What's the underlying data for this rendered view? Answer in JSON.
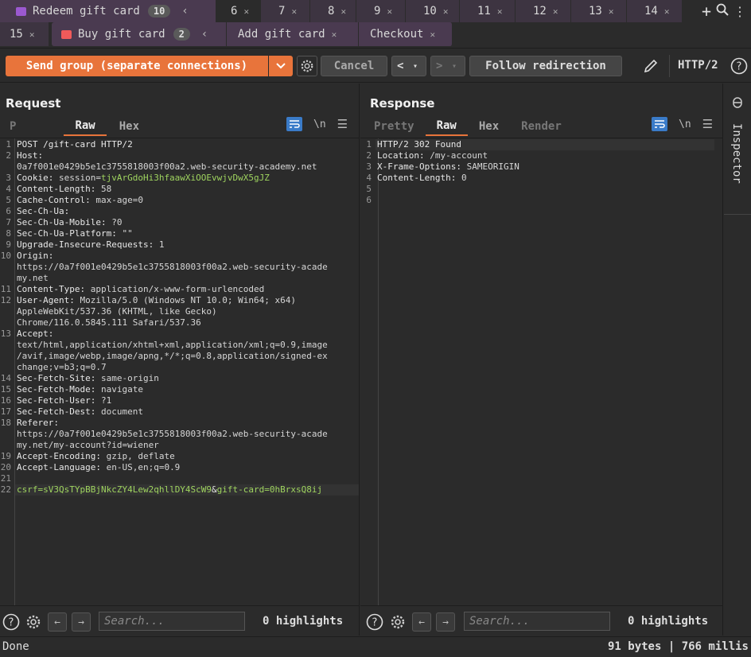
{
  "tabs_row1": {
    "group": {
      "label": "Redeem gift card",
      "count": "10"
    },
    "tabs": [
      "6",
      "7",
      "8",
      "9",
      "10",
      "11",
      "12",
      "13",
      "14"
    ],
    "active": "6"
  },
  "tabs_row2": {
    "first": "15",
    "group": {
      "label": "Buy gift card",
      "count": "2"
    },
    "tabs": [
      "Add gift card",
      "Checkout"
    ]
  },
  "toolbar": {
    "send_label": "Send group (separate connections)",
    "cancel_label": "Cancel",
    "follow_label": "Follow redirection",
    "protocol": "HTTP/2"
  },
  "request": {
    "title": "Request",
    "tabs": {
      "pretty": "P",
      "raw": "Raw",
      "hex": "Hex"
    },
    "newline_toggle": "\\n",
    "lines": [
      {
        "n": "1",
        "parts": [
          [
            "k",
            "POST /gift-card HTTP/2"
          ]
        ]
      },
      {
        "n": "2",
        "parts": [
          [
            "k",
            "Host:"
          ]
        ]
      },
      {
        "n": "",
        "parts": [
          [
            "t",
            "0a7f001e0429b5e1c3755818003f00a2.web-security-academy.net"
          ]
        ]
      },
      {
        "n": "3",
        "parts": [
          [
            "k",
            "Cookie: "
          ],
          [
            "t",
            "session="
          ],
          [
            "hl",
            "tjvArGdoHi3hfaawXiOOEvwjvDwX5gJZ"
          ]
        ]
      },
      {
        "n": "4",
        "parts": [
          [
            "k",
            "Content-Length: "
          ],
          [
            "t",
            "58"
          ]
        ]
      },
      {
        "n": "5",
        "parts": [
          [
            "k",
            "Cache-Control: "
          ],
          [
            "t",
            "max-age=0"
          ]
        ]
      },
      {
        "n": "6",
        "parts": [
          [
            "k",
            "Sec-Ch-Ua:"
          ]
        ]
      },
      {
        "n": "7",
        "parts": [
          [
            "k",
            "Sec-Ch-Ua-Mobile: "
          ],
          [
            "t",
            "?0"
          ]
        ]
      },
      {
        "n": "8",
        "parts": [
          [
            "k",
            "Sec-Ch-Ua-Platform: "
          ],
          [
            "t",
            "\"\""
          ]
        ]
      },
      {
        "n": "9",
        "parts": [
          [
            "k",
            "Upgrade-Insecure-Requests: "
          ],
          [
            "t",
            "1"
          ]
        ]
      },
      {
        "n": "10",
        "parts": [
          [
            "k",
            "Origin:"
          ]
        ]
      },
      {
        "n": "",
        "parts": [
          [
            "t",
            "https://0a7f001e0429b5e1c3755818003f00a2.web-security-acade"
          ]
        ]
      },
      {
        "n": "",
        "parts": [
          [
            "t",
            "my.net"
          ]
        ]
      },
      {
        "n": "11",
        "parts": [
          [
            "k",
            "Content-Type: "
          ],
          [
            "t",
            "application/x-www-form-urlencoded"
          ]
        ]
      },
      {
        "n": "12",
        "parts": [
          [
            "k",
            "User-Agent: "
          ],
          [
            "t",
            "Mozilla/5.0 (Windows NT 10.0; Win64; x64)"
          ]
        ]
      },
      {
        "n": "",
        "parts": [
          [
            "t",
            "AppleWebKit/537.36 (KHTML, like Gecko)"
          ]
        ]
      },
      {
        "n": "",
        "parts": [
          [
            "t",
            "Chrome/116.0.5845.111 Safari/537.36"
          ]
        ]
      },
      {
        "n": "13",
        "parts": [
          [
            "k",
            "Accept:"
          ]
        ]
      },
      {
        "n": "",
        "parts": [
          [
            "t",
            "text/html,application/xhtml+xml,application/xml;q=0.9,image"
          ]
        ]
      },
      {
        "n": "",
        "parts": [
          [
            "t",
            "/avif,image/webp,image/apng,*/*;q=0.8,application/signed-ex"
          ]
        ]
      },
      {
        "n": "",
        "parts": [
          [
            "t",
            "change;v=b3;q=0.7"
          ]
        ]
      },
      {
        "n": "14",
        "parts": [
          [
            "k",
            "Sec-Fetch-Site: "
          ],
          [
            "t",
            "same-origin"
          ]
        ]
      },
      {
        "n": "15",
        "parts": [
          [
            "k",
            "Sec-Fetch-Mode: "
          ],
          [
            "t",
            "navigate"
          ]
        ]
      },
      {
        "n": "16",
        "parts": [
          [
            "k",
            "Sec-Fetch-User: "
          ],
          [
            "t",
            "?1"
          ]
        ]
      },
      {
        "n": "17",
        "parts": [
          [
            "k",
            "Sec-Fetch-Dest: "
          ],
          [
            "t",
            "document"
          ]
        ]
      },
      {
        "n": "18",
        "parts": [
          [
            "k",
            "Referer:"
          ]
        ]
      },
      {
        "n": "",
        "parts": [
          [
            "t",
            "https://0a7f001e0429b5e1c3755818003f00a2.web-security-acade"
          ]
        ]
      },
      {
        "n": "",
        "parts": [
          [
            "t",
            "my.net/my-account?id=wiener"
          ]
        ]
      },
      {
        "n": "19",
        "parts": [
          [
            "k",
            "Accept-Encoding: "
          ],
          [
            "t",
            "gzip, deflate"
          ]
        ]
      },
      {
        "n": "20",
        "parts": [
          [
            "k",
            "Accept-Language: "
          ],
          [
            "t",
            "en-US,en;q=0.9"
          ]
        ]
      },
      {
        "n": "21",
        "parts": []
      },
      {
        "n": "22",
        "cur": true,
        "parts": [
          [
            "hl",
            "csrf="
          ],
          [
            "hl",
            "sV3QsTYpBBjNkcZY4Lew2qhllDY4ScW9"
          ],
          [
            "k",
            "&"
          ],
          [
            "hl",
            "gift-card="
          ],
          [
            "hl",
            "0hBrxsQ8ij"
          ]
        ]
      }
    ],
    "search_placeholder": "Search...",
    "highlights": "0 highlights"
  },
  "response": {
    "title": "Response",
    "tabs": {
      "pretty": "Pretty",
      "raw": "Raw",
      "hex": "Hex",
      "render": "Render"
    },
    "newline_toggle": "\\n",
    "lines": [
      {
        "n": "1",
        "cur": true,
        "parts": [
          [
            "k",
            "HTTP/2 302 Found"
          ]
        ]
      },
      {
        "n": "2",
        "parts": [
          [
            "k",
            "Location: "
          ],
          [
            "t",
            "/my-account"
          ]
        ]
      },
      {
        "n": "3",
        "parts": [
          [
            "k",
            "X-Frame-Options: "
          ],
          [
            "t",
            "SAMEORIGIN"
          ]
        ]
      },
      {
        "n": "4",
        "parts": [
          [
            "k",
            "Content-Length: "
          ],
          [
            "t",
            "0"
          ]
        ]
      },
      {
        "n": "5",
        "parts": []
      },
      {
        "n": "6",
        "parts": []
      }
    ],
    "search_placeholder": "Search...",
    "highlights": "0 highlights"
  },
  "inspector": {
    "label": "Inspector"
  },
  "status": {
    "left": "Done",
    "right": "91 bytes | 766 millis"
  },
  "colors": {
    "accent": "#e8743b",
    "highlight_text": "#9fd45f",
    "toggle_on": "#3a7bc8",
    "group_purple": "#9b59d0",
    "group_red": "#f05a5a"
  }
}
